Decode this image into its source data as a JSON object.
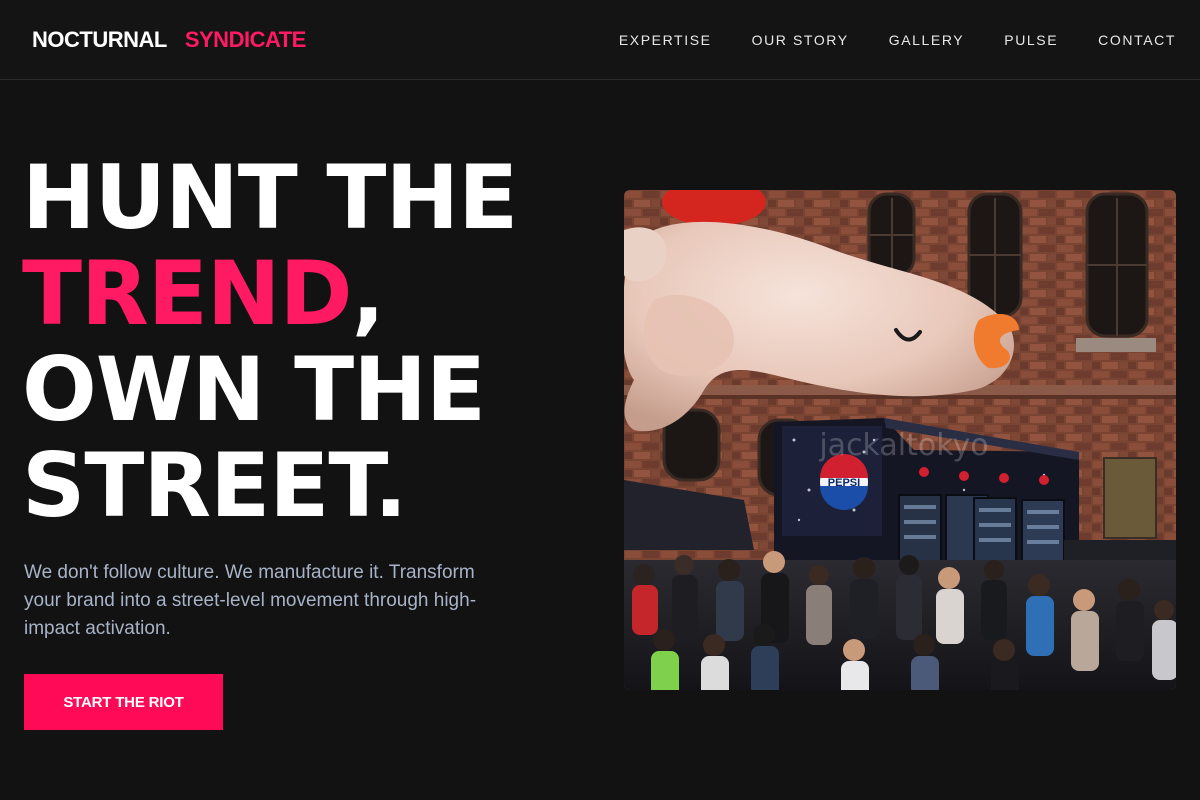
{
  "brand": {
    "part1": "NOCTURNAL",
    "part2": "SYNDICATE"
  },
  "nav": [
    {
      "label": "EXPERTISE"
    },
    {
      "label": "OUR STORY"
    },
    {
      "label": "GALLERY"
    },
    {
      "label": "PULSE"
    },
    {
      "label": "CONTACT"
    }
  ],
  "hero": {
    "line1": "HUNT THE",
    "line2_accent": "TREND",
    "line2_rest": ",",
    "line3": "OWN THE",
    "line4": "STREET.",
    "subtext": "We don't follow culture. We manufacture it. Transform your brand into a street-level movement through high-impact activation.",
    "cta_label": "START THE RIOT",
    "image": {
      "sign_text": "PEPSI",
      "watermark": "jackaltokyo"
    }
  },
  "colors": {
    "accent": "#ff1a63",
    "background": "#121213",
    "subtext": "#a8b3c7"
  }
}
